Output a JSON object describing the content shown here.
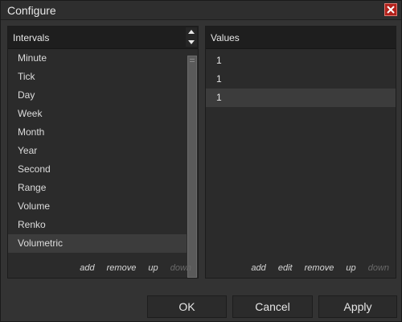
{
  "window": {
    "title": "Configure",
    "close_icon": "close-x-icon"
  },
  "intervals_panel": {
    "header": "Intervals",
    "items": [
      "Minute",
      "Tick",
      "Day",
      "Week",
      "Month",
      "Year",
      "Second",
      "Range",
      "Volume",
      "Renko",
      "Volumetric"
    ],
    "selected_index": 10,
    "actions": {
      "add": "add",
      "remove": "remove",
      "up": "up",
      "down": "down"
    }
  },
  "values_panel": {
    "header": "Values",
    "items": [
      "1",
      "1",
      "1"
    ],
    "selected_index": 2,
    "actions": {
      "add": "add",
      "edit": "edit",
      "remove": "remove",
      "up": "up",
      "down": "down"
    }
  },
  "buttons": {
    "ok": "OK",
    "cancel": "Cancel",
    "apply": "Apply"
  },
  "colors": {
    "background": "#333333",
    "panel": "#2b2b2b",
    "header": "#1e1e1e",
    "selected_row": "#3c3c3c",
    "close_button": "#b2211b",
    "disabled_text": "#6a6a6a"
  }
}
